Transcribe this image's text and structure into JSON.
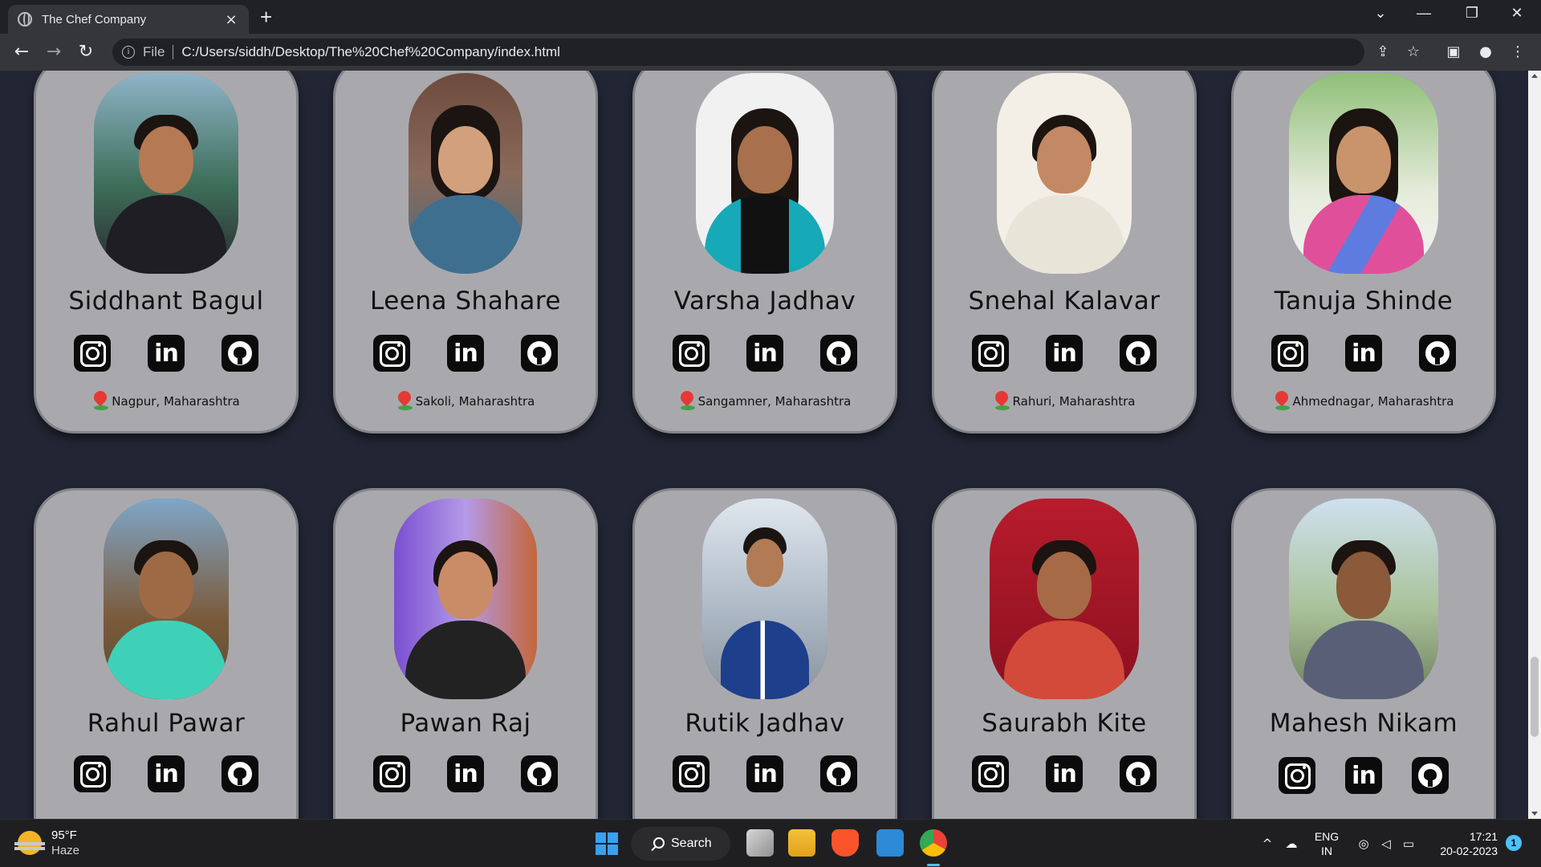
{
  "browser": {
    "tab_title": "The Chef Company",
    "tab_close_icon": "×",
    "new_tab_icon": "+",
    "window_controls": {
      "dropdown": "⌄",
      "minimize": "—",
      "restore": "❐",
      "close": "✕"
    },
    "nav": {
      "back": "←",
      "forward": "→",
      "reload": "↻"
    },
    "omnibox": {
      "scheme_label": "File",
      "url": "C:/Users/siddh/Desktop/The%20Chef%20Company/index.html"
    },
    "toolbar_icons": [
      "share-icon",
      "bookmark-star-icon",
      "side-panel-icon",
      "profile-icon",
      "menu-icon"
    ]
  },
  "page": {
    "background": "#222533",
    "card_color": "#a9a9ad",
    "members": [
      {
        "name": "Siddhant Bagul",
        "location": "Nagpur, Maharashtra"
      },
      {
        "name": "Leena Shahare",
        "location": "Sakoli, Maharashtra"
      },
      {
        "name": "Varsha Jadhav",
        "location": "Sangamner, Maharashtra"
      },
      {
        "name": "Snehal Kalavar",
        "location": "Rahuri, Maharashtra"
      },
      {
        "name": "Tanuja Shinde",
        "location": "Ahmednagar, Maharashtra"
      },
      {
        "name": "Rahul Pawar"
      },
      {
        "name": "Pawan Raj"
      },
      {
        "name": "Rutik Jadhav"
      },
      {
        "name": "Saurabh Kite"
      },
      {
        "name": "Mahesh Nikam"
      }
    ],
    "social_icons": [
      "instagram-icon",
      "linkedin-icon",
      "github-icon"
    ],
    "linkedin_glyph": "in"
  },
  "taskbar": {
    "weather": {
      "temp": "95°F",
      "condition": "Haze"
    },
    "search_label": "Search",
    "language": {
      "lang": "ENG",
      "region": "IN"
    },
    "clock": {
      "time": "17:21",
      "date": "20-02-2023"
    },
    "notification_count": "1"
  }
}
